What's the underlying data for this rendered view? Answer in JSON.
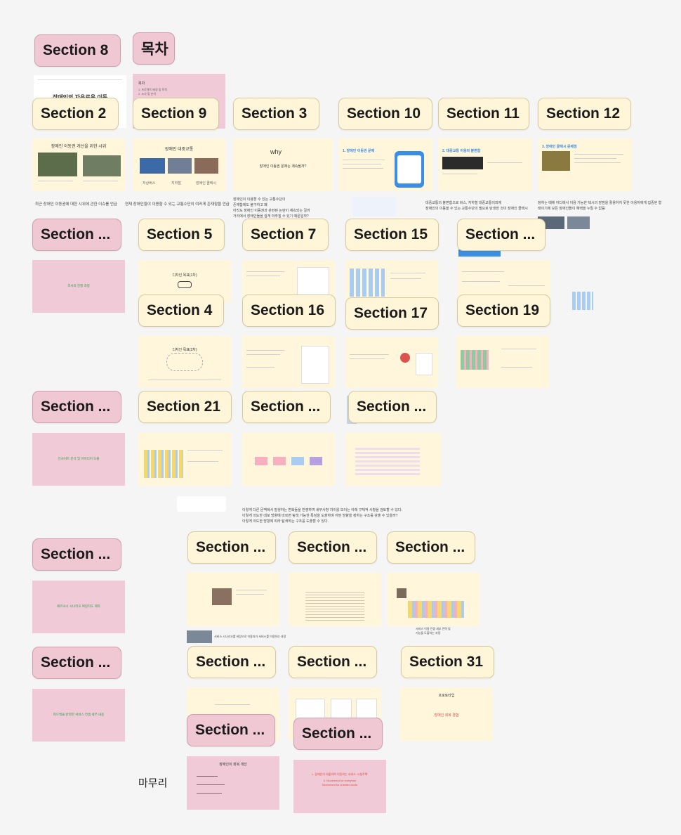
{
  "labels": {
    "s8": "Section 8",
    "toc": "목차",
    "s2": "Section 2",
    "s9": "Section 9",
    "s3": "Section 3",
    "s10": "Section 10",
    "s11": "Section 11",
    "s12": "Section 12",
    "r3a": "Section ...",
    "s5": "Section 5",
    "s7": "Section 7",
    "s15": "Section 15",
    "r3b": "Section ...",
    "s4": "Section 4",
    "s16": "Section 16",
    "s17": "Section 17",
    "s19": "Section 19",
    "r5a": "Section ...",
    "s21": "Section 21",
    "r5b": "Section ...",
    "r5c": "Section ...",
    "r7a": "Section ...",
    "r7b": "Section ...",
    "r7c": "Section ...",
    "r7d": "Section ...",
    "r8a": "Section ...",
    "r8b": "Section ...",
    "r8c": "Section ...",
    "s31": "Section 31",
    "r9a": "Section ...",
    "r9b": "Section ..."
  },
  "slides": {
    "s2_title": "장애인 이동권 개선을 위한 시위",
    "s9_title": "장애인 대중교통",
    "s9_items": [
      "저상버스",
      "지하철",
      "장애인 콜택시"
    ],
    "s3_title": "why",
    "s3_sub": "장애인 이동권 문제는 계속될까?",
    "s10_title": "1. 장애인 이동권 문제",
    "s11_title": "2. 대중교통 이용의 불편함",
    "s12_title": "3. 장애인 콜택시 문제점",
    "r3a_slide": "조사의 진행 과정",
    "s5_title": "디자인 목표(1차)",
    "s4_title": "디자인 목표(2차)",
    "r5a_slide": "인사이트 분석 및 아이디어 도출",
    "r7a_slide": "페르소나 시나리오 여정지도 제작",
    "r8a_slide": "피드백을 반영한 서비스 컨셉 세부 내용",
    "s31_title": "프로토타입",
    "s31_sub": "장애인 회복 경험",
    "r9a_title": "장애인이 회복 개선",
    "r9b_line1": "1. 장애인이 외출하며 이동하는 서비스 '시설주택'",
    "r9b_line2": "2. Movement for everyone",
    "r9b_line3": "Movement for a better world",
    "toc_head": "목차",
    "toc_items": [
      "1. 프로젝트 배경 및 목적",
      "2. 조사 및 분석"
    ],
    "s8_slide": "장애인의 자유로운 이동"
  },
  "captions": {
    "row2_left": "최근 장애인 이동권에 대한 시위에 관한 이슈를 언급",
    "row2_mid": "현재 장애인들이 이용할 수 있는 교통수단이 여러게 존재함을 언급",
    "row2_why": [
      "장애인이 이용할 수 있는 교통수단이",
      "존재함에도 불구하고 왜",
      "아직도 장애인 이동권과 관련된 논란이 계속되는 걸까",
      "거리에서 장애인들을 쉽게 마주칠 수 있기 때문일까?"
    ],
    "row2_right1": [
      "대중교통의 불편함으로 버스, 지하철 대중교통이외에",
      "장애인의 이동을 수 있는 교통수단의 필요로 탄생한 것이 장애인 콜택시"
    ],
    "row2_right2": "정하는 때에 어디에서 이용 가능한 택시의 장점을 활용하지 못한 이용자에게 집중된 형태이기에 모든 장애인들이 혜택을 누릴 수 없음",
    "mid_notes": [
      "이렇게 다른 문맥에서 발생하는 변화들을 반영하여 세부사항 차이를 보이는 아래 구체적 사항을 검토할 수 있다.",
      "이렇게 의도한 대로 방향에 따르면 탐색 가능한 특징을 도출하며 어떤 방향을 정하는 구조를 갖출 수 있을까?",
      "이렇게 의도한 방향에 따라 탐색하는 구조를 도출할 수 있다."
    ],
    "cap_bottom1": "서비스 시나리오를 바탕으로 이용자가 서비스를 이용하는 과정",
    "cap_bottom2": [
      "서비스 이용 컨셉 세부 전략 및",
      "기능을 도출하는 과정"
    ]
  },
  "free_text": {
    "ending": "마무리"
  },
  "colors": {
    "background": "#f5f5f5",
    "label_yellow": "#fff6d9",
    "label_pink": "#f0c8d4",
    "slide_yellow": "#fff6dc",
    "slide_pink": "#f0cad6",
    "accent_blue": "#3a8ee6",
    "accent_red": "#e04a3a",
    "accent_green": "#2a9d4a"
  }
}
